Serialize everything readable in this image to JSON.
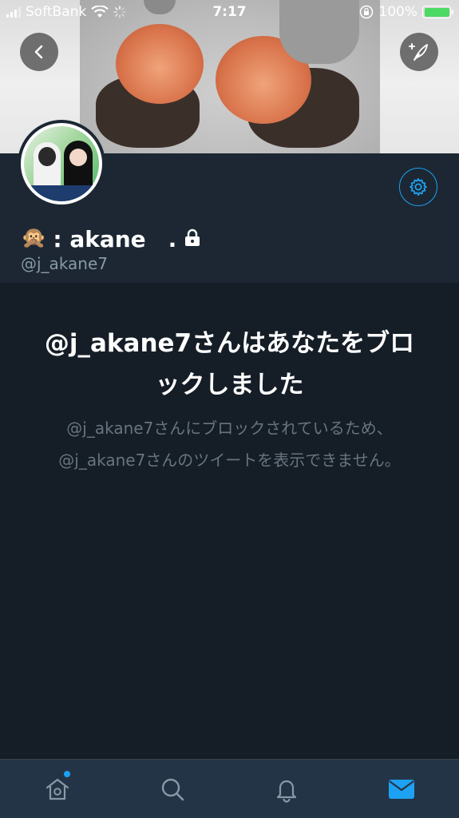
{
  "status_bar": {
    "carrier": "SoftBank",
    "time": "7:17",
    "battery": "100%",
    "battery_level": 1.0
  },
  "profile": {
    "display_name": ": akane　.",
    "handle": "@j_akane7",
    "name_emoji": "🙊"
  },
  "blocked": {
    "title": "@j_akane7さんはあなたをブロックしました",
    "description": "@j_akane7さんにブロックされているため、@j_akane7さんのツイートを表示できません。"
  },
  "icons": {
    "back": "back-arrow-icon",
    "compose": "compose-tweet-icon",
    "settings": "gear-icon",
    "lock": "lock-icon",
    "home": "home-icon",
    "search": "search-icon",
    "notifications": "bell-icon",
    "messages": "envelope-icon"
  },
  "colors": {
    "accent": "#1da1f2",
    "background": "#151d26",
    "profile_bg": "#1c2733",
    "tab_bar_bg": "#243447",
    "muted_text": "#66757f"
  }
}
